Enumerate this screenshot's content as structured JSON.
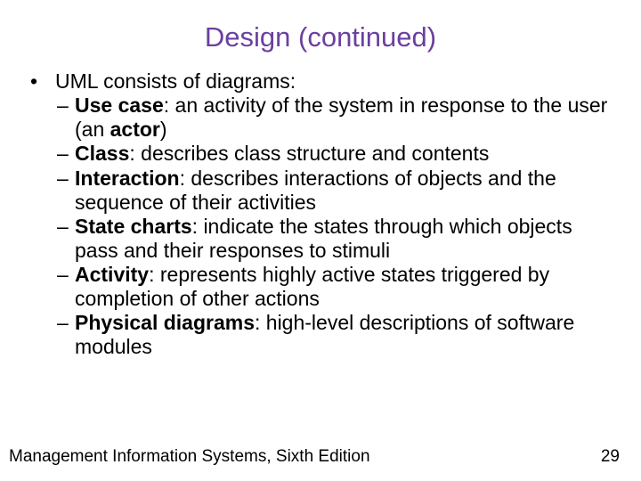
{
  "title": "Design (continued)",
  "intro": "UML consists of diagrams:",
  "items": [
    {
      "label": "Use case",
      "desc_pre": ": an activity of the system in response to the user (an ",
      "bold": "actor",
      "desc_post": ")"
    },
    {
      "label": "Class",
      "desc_pre": ": describes class structure and contents",
      "bold": "",
      "desc_post": ""
    },
    {
      "label": "Interaction",
      "desc_pre": ": describes interactions of objects and the sequence of their activities",
      "bold": "",
      "desc_post": ""
    },
    {
      "label": "State charts",
      "desc_pre": ": indicate the states through which objects pass and their responses to stimuli",
      "bold": "",
      "desc_post": ""
    },
    {
      "label": "Activity",
      "desc_pre": ": represents highly active states triggered by completion of other actions",
      "bold": "",
      "desc_post": ""
    },
    {
      "label": "Physical diagrams",
      "desc_pre": ": high-level descriptions of software modules",
      "bold": "",
      "desc_post": ""
    }
  ],
  "footer_left": "Management Information Systems, Sixth Edition",
  "footer_right": "29"
}
